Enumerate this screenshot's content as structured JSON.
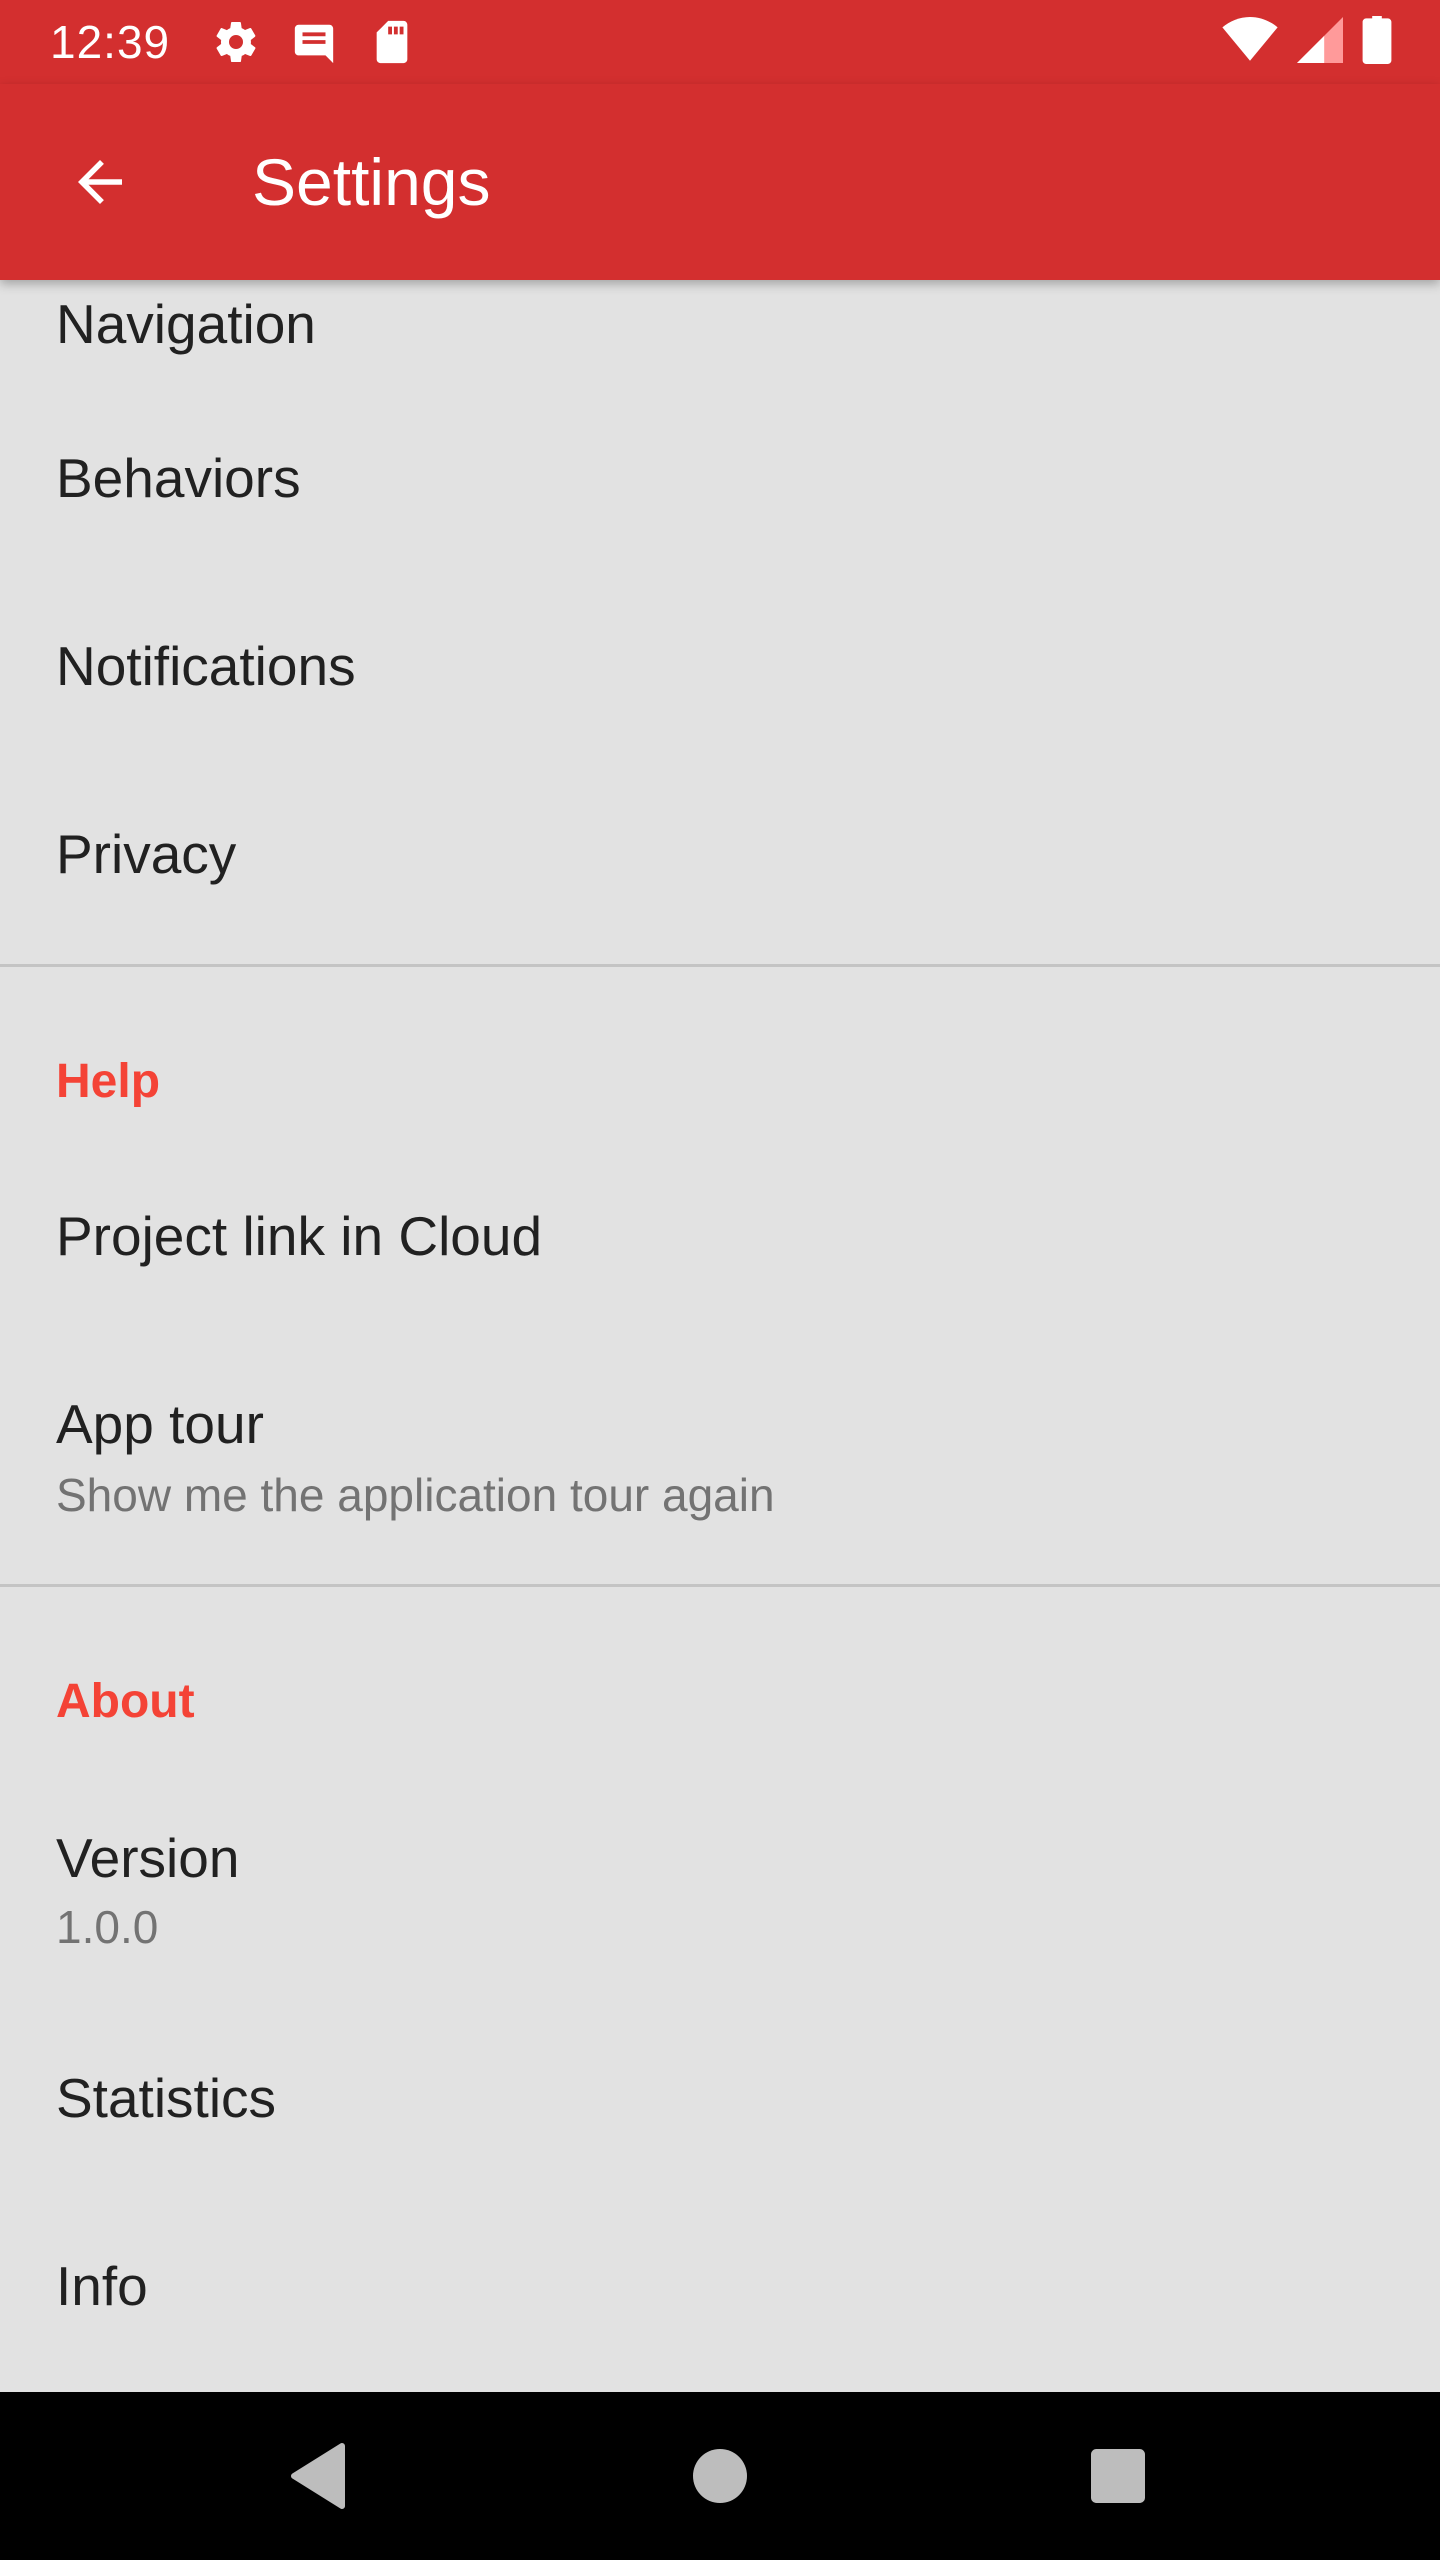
{
  "status_bar": {
    "time": "12:39",
    "left_icons": [
      "gear-icon",
      "message-icon",
      "sd-card-icon"
    ],
    "right_icons": [
      "wifi-icon",
      "cell-signal-icon",
      "battery-icon"
    ]
  },
  "app_bar": {
    "title": "Settings",
    "back_icon": "arrow-back-icon",
    "color": "#d32f2f"
  },
  "settings": {
    "general_items": [
      {
        "title": "Navigation"
      },
      {
        "title": "Behaviors"
      },
      {
        "title": "Notifications"
      },
      {
        "title": "Privacy"
      }
    ],
    "help": {
      "category": "Help",
      "items": [
        {
          "title": "Project link in Cloud"
        },
        {
          "title": "App tour",
          "summary": "Show me the application tour again"
        }
      ]
    },
    "about": {
      "category": "About",
      "items": [
        {
          "title": "Version",
          "summary": "1.0.0"
        },
        {
          "title": "Statistics"
        },
        {
          "title": "Info"
        }
      ]
    },
    "category_color": "#f44336"
  },
  "nav_bar": {
    "buttons": [
      "back-triangle-icon",
      "home-circle-icon",
      "recents-square-icon"
    ]
  }
}
